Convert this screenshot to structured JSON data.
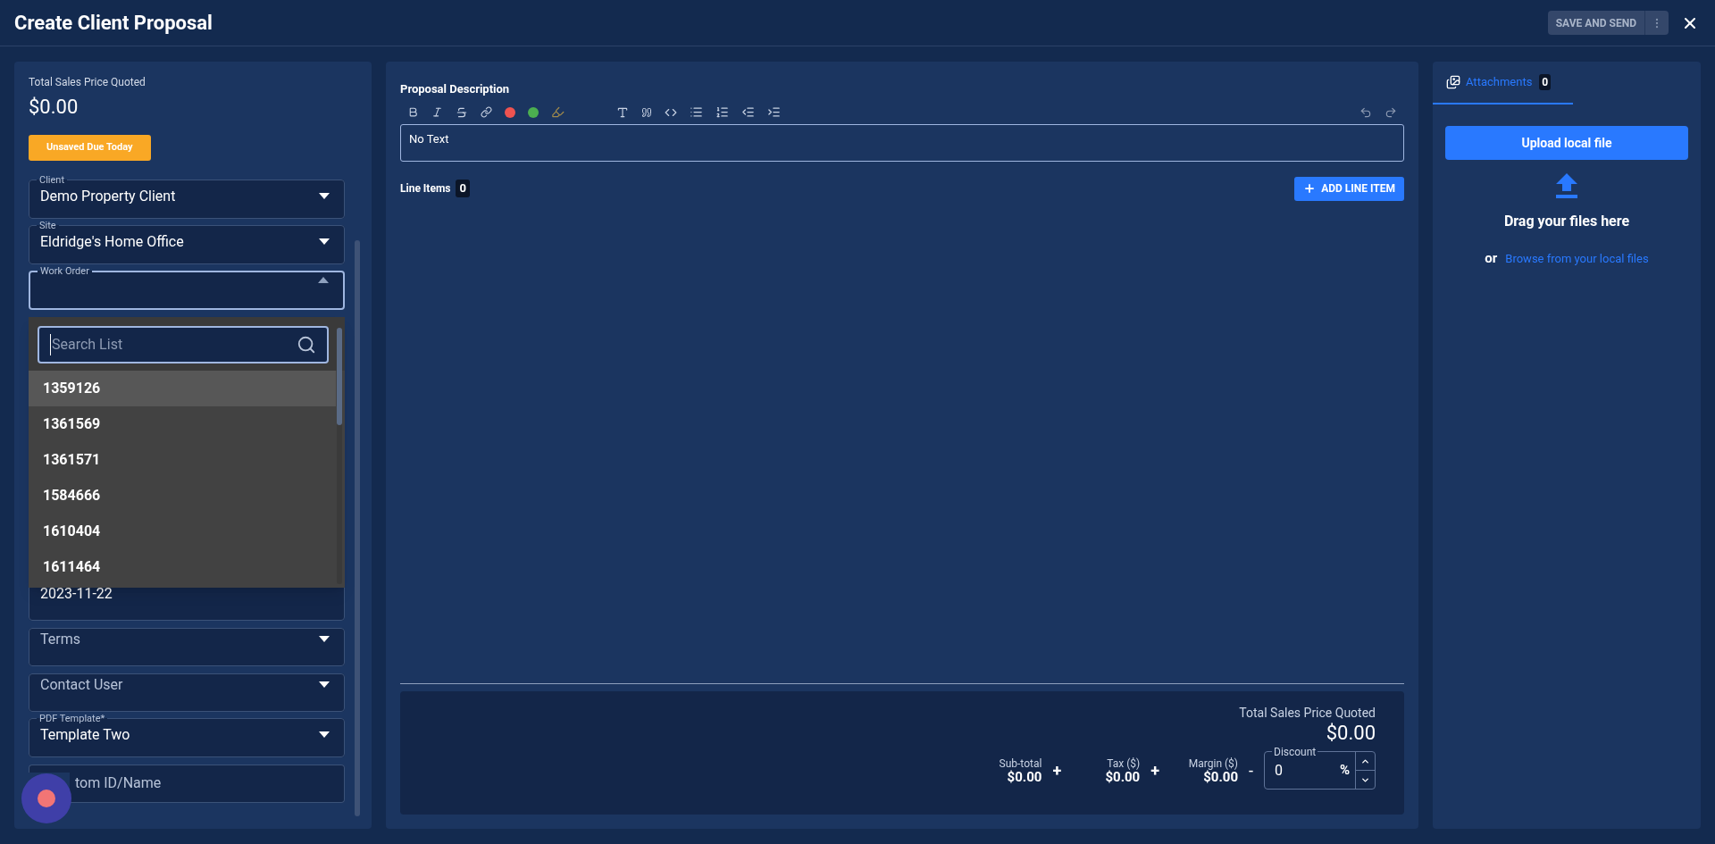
{
  "header": {
    "title": "Create Client Proposal",
    "save_button": "SAVE AND SEND"
  },
  "summary": {
    "label": "Total Sales Price Quoted",
    "amount": "$0.00",
    "status_badge": "Unsaved Due Today"
  },
  "fields": [
    {
      "kind": "select",
      "label": "Client",
      "value": "Demo Property Client",
      "expanded": false
    },
    {
      "kind": "select",
      "label": "Site",
      "value": "Eldridge's Home Office",
      "expanded": false
    },
    {
      "kind": "select",
      "label": "Work Order",
      "expanded": true,
      "dropdown": {
        "search_placeholder": "Search List",
        "options": [
          {
            "label": "1359126",
            "highlighted": true
          },
          {
            "label": "1361569",
            "highlighted": false
          },
          {
            "label": "1361571",
            "highlighted": false
          },
          {
            "label": "1584666",
            "highlighted": false
          },
          {
            "label": "1610404",
            "highlighted": false
          },
          {
            "label": "1611464",
            "highlighted": false
          }
        ]
      }
    },
    {
      "kind": "text",
      "value": "2023-11-22"
    },
    {
      "kind": "select",
      "placeholder": "Terms",
      "expanded": false
    },
    {
      "kind": "select",
      "placeholder": "Contact User",
      "expanded": false
    },
    {
      "kind": "select",
      "label": "PDF Template*",
      "value": "Template Two",
      "expanded": false
    },
    {
      "kind": "text",
      "placeholder": "tom ID/Name"
    }
  ],
  "editor": {
    "label": "Proposal Description",
    "value": "No Text"
  },
  "line_items": {
    "label": "Line Items",
    "count": "0",
    "add_button": "ADD LINE ITEM"
  },
  "totals": {
    "label": "Total Sales Price Quoted",
    "amount": "$0.00",
    "parts": [
      {
        "label": "Sub-total",
        "value": "$0.00",
        "operator": "+"
      },
      {
        "label": "Tax ($)",
        "value": "$0.00",
        "operator": "+"
      },
      {
        "label": "Margin ($)",
        "value": "$0.00",
        "operator": "-"
      }
    ],
    "discount": {
      "label": "Discount",
      "value": "0",
      "unit": "%"
    }
  },
  "attachments": {
    "tab": {
      "label": "Attachments",
      "count": "0",
      "selected": true
    },
    "upload_button": "Upload local file",
    "drop_text": "Drag your files here",
    "or": "or",
    "browse_link": "Browse from your local files"
  }
}
